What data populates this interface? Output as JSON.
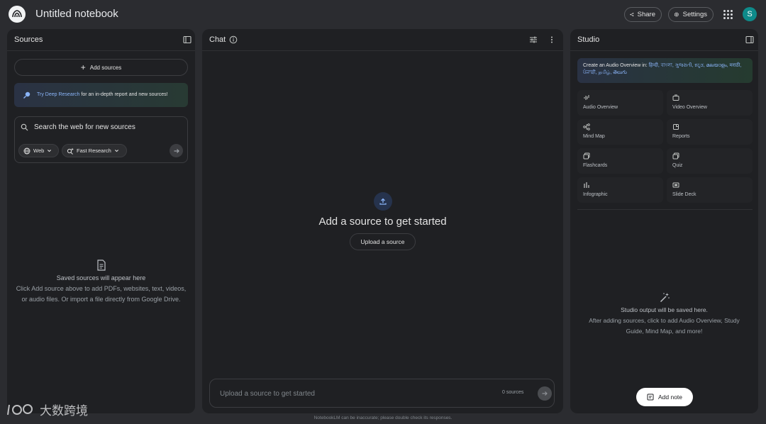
{
  "app": {
    "title": "Untitled notebook",
    "logo_icon": "notebooklm-logo-icon",
    "share_label": "Share",
    "settings_label": "Settings",
    "avatar_initial": "S"
  },
  "sources": {
    "title": "Sources",
    "add_sources_label": "Add sources",
    "deep_research": {
      "link_text": "Try Deep Research",
      "rest_text": " for an in-depth report and new sources!"
    },
    "search": {
      "placeholder": "Search the web for new sources",
      "web_chip": "Web",
      "mode_chip": "Fast Research"
    },
    "empty": {
      "title": "Saved sources will appear here",
      "body": "Click Add source above to add PDFs, websites, text, videos, or audio files. Or import a file directly from Google Drive."
    }
  },
  "chat": {
    "title": "Chat",
    "heading": "Add a source to get started",
    "upload_label": "Upload a source",
    "input_placeholder": "Upload a source to get started",
    "source_count": "0 sources"
  },
  "studio": {
    "title": "Studio",
    "audio_banner": {
      "prefix": "Create an Audio Overview in: ",
      "languages": "हिन्दी, বাংলা, ગુજરાતી, ಕನ್ನಡ, മലയാളം, मराठी, ਪੰਜਾਬੀ, தமிழ், తెలుగు"
    },
    "tiles": [
      {
        "label": "Audio Overview",
        "icon": "audio-waveform-icon"
      },
      {
        "label": "Video Overview",
        "icon": "video-icon"
      },
      {
        "label": "Mind Map",
        "icon": "mind-map-icon"
      },
      {
        "label": "Reports",
        "icon": "reports-icon"
      },
      {
        "label": "Flashcards",
        "icon": "flashcards-icon"
      },
      {
        "label": "Quiz",
        "icon": "quiz-icon"
      },
      {
        "label": "Infographic",
        "icon": "infographic-icon"
      },
      {
        "label": "Slide Deck",
        "icon": "slide-deck-icon"
      }
    ],
    "empty": {
      "title": "Studio output will be saved here.",
      "body": "After adding sources, click to add Audio Overview, Study Guide, Mind Map, and more!"
    },
    "add_note_label": "Add note"
  },
  "footer": {
    "disclaimer": "NotebookLM can be inaccurate; please double check its responses."
  },
  "watermark": {
    "text": "大数跨境"
  },
  "colors": {
    "background": "#2b2c30",
    "panel": "#1f2023",
    "accent_link": "#8ab4f8",
    "avatar": "#0e8a8a"
  }
}
